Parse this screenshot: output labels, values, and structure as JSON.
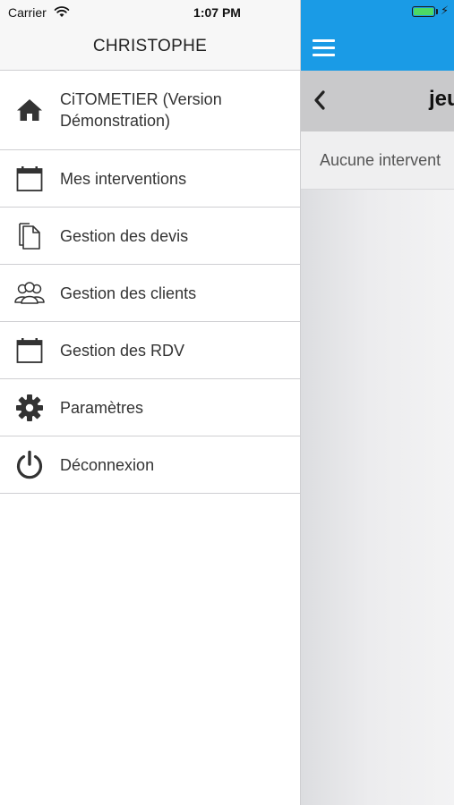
{
  "status_bar": {
    "carrier": "Carrier",
    "time": "1:07 PM",
    "bolt": "⚡"
  },
  "menu": {
    "title": "CHRISTOPHE",
    "items": [
      {
        "label": "CiTOMETIER (Version Démonstration)",
        "icon": "home-icon"
      },
      {
        "label": "Mes interventions",
        "icon": "calendar-icon"
      },
      {
        "label": "Gestion des devis",
        "icon": "document-icon"
      },
      {
        "label": "Gestion des clients",
        "icon": "users-icon"
      },
      {
        "label": "Gestion des RDV",
        "icon": "calendar-icon"
      },
      {
        "label": "Paramètres",
        "icon": "gear-icon"
      },
      {
        "label": "Déconnexion",
        "icon": "power-icon"
      }
    ]
  },
  "main": {
    "date_title": "jeu",
    "empty_text": "Aucune intervent"
  },
  "colors": {
    "accent": "#1a9be6",
    "battery": "#4cd964",
    "icon": "#333333"
  }
}
